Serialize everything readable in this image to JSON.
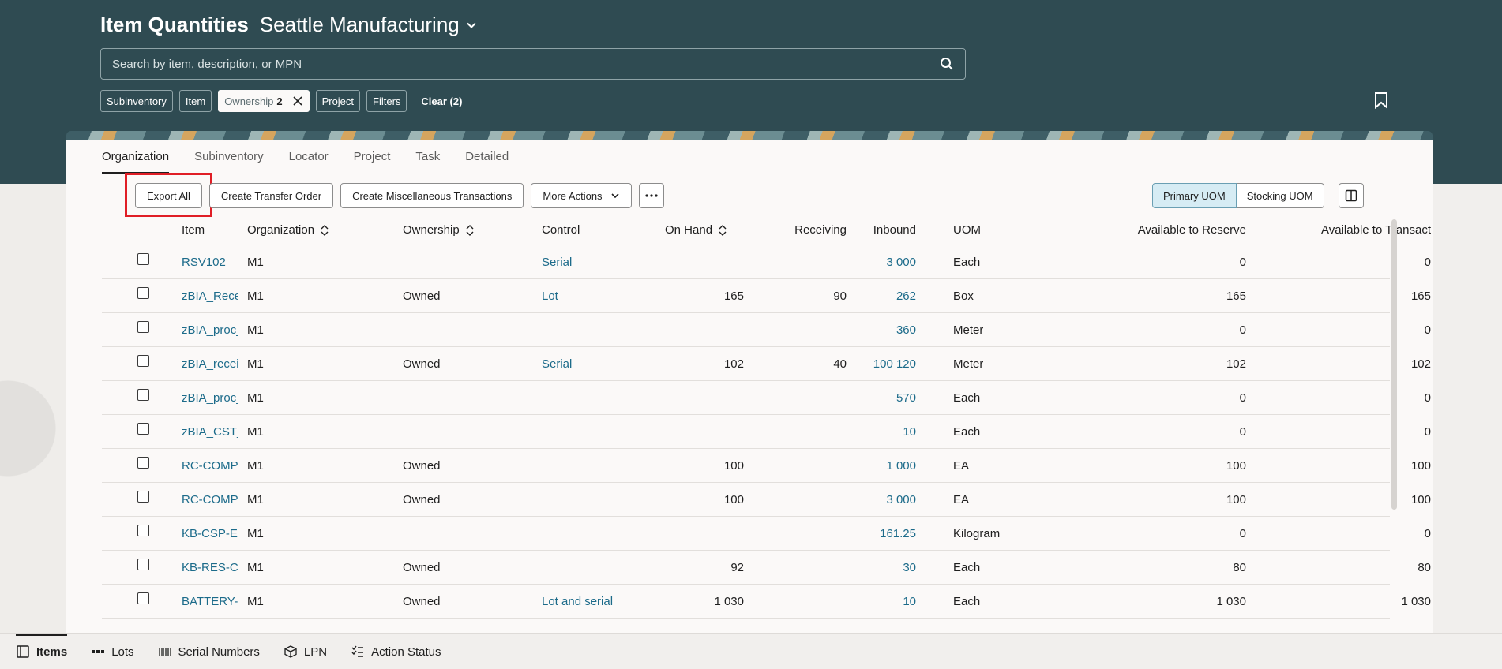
{
  "header": {
    "title": "Item Quantities",
    "organization": "Seattle Manufacturing",
    "search_placeholder": "Search by item, description, or MPN",
    "chips": {
      "subinventory": "Subinventory",
      "item": "Item",
      "ownership_label": "Ownership",
      "ownership_count": "2",
      "project": "Project",
      "filters": "Filters"
    },
    "clear_label": "Clear (2)"
  },
  "tabs": [
    "Organization",
    "Subinventory",
    "Locator",
    "Project",
    "Task",
    "Detailed"
  ],
  "toolbar": {
    "export_all": "Export All",
    "create_transfer_order": "Create Transfer Order",
    "create_misc_transactions": "Create Miscellaneous Transactions",
    "more_actions": "More Actions",
    "primary_uom": "Primary UOM",
    "stocking_uom": "Stocking UOM"
  },
  "table": {
    "columns": {
      "item": "Item",
      "organization": "Organization",
      "ownership": "Ownership",
      "control": "Control",
      "on_hand": "On Hand",
      "receiving": "Receiving",
      "inbound": "Inbound",
      "uom": "UOM",
      "available_to_reserve": "Available to Reserve",
      "available_to_transact": "Available to Transact"
    },
    "rows": [
      {
        "item": "RSV102",
        "org": "M1",
        "ownership": "",
        "control": "Serial",
        "on_hand": "",
        "receiving": "",
        "inbound": "3 000",
        "uom": "Each",
        "atr": "0",
        "att": "0"
      },
      {
        "item": "zBIA_Rece",
        "org": "M1",
        "ownership": "Owned",
        "control": "Lot",
        "on_hand": "165",
        "receiving": "90",
        "inbound": "262",
        "uom": "Box",
        "atr": "165",
        "att": "165"
      },
      {
        "item": "zBIA_proc_",
        "org": "M1",
        "ownership": "",
        "control": "",
        "on_hand": "",
        "receiving": "",
        "inbound": "360",
        "uom": "Meter",
        "atr": "0",
        "att": "0"
      },
      {
        "item": "zBIA_recei",
        "org": "M1",
        "ownership": "Owned",
        "control": "Serial",
        "on_hand": "102",
        "receiving": "40",
        "inbound": "100 120",
        "uom": "Meter",
        "atr": "102",
        "att": "102"
      },
      {
        "item": "zBIA_proc_",
        "org": "M1",
        "ownership": "",
        "control": "",
        "on_hand": "",
        "receiving": "",
        "inbound": "570",
        "uom": "Each",
        "atr": "0",
        "att": "0"
      },
      {
        "item": "zBIA_CST_",
        "org": "M1",
        "ownership": "",
        "control": "",
        "on_hand": "",
        "receiving": "",
        "inbound": "10",
        "uom": "Each",
        "atr": "0",
        "att": "0"
      },
      {
        "item": "RC-COMP-",
        "org": "M1",
        "ownership": "Owned",
        "control": "",
        "on_hand": "100",
        "receiving": "",
        "inbound": "1 000",
        "uom": "EA",
        "atr": "100",
        "att": "100"
      },
      {
        "item": "RC-COMP-",
        "org": "M1",
        "ownership": "Owned",
        "control": "",
        "on_hand": "100",
        "receiving": "",
        "inbound": "3 000",
        "uom": "EA",
        "atr": "100",
        "att": "100"
      },
      {
        "item": "KB-CSP-EI",
        "org": "M1",
        "ownership": "",
        "control": "",
        "on_hand": "",
        "receiving": "",
        "inbound": "161.25",
        "uom": "Kilogram",
        "atr": "0",
        "att": "0"
      },
      {
        "item": "KB-RES-C(",
        "org": "M1",
        "ownership": "Owned",
        "control": "",
        "on_hand": "92",
        "receiving": "",
        "inbound": "30",
        "uom": "Each",
        "atr": "80",
        "att": "80"
      },
      {
        "item": "BATTERY-",
        "org": "M1",
        "ownership": "Owned",
        "control": "Lot and serial",
        "on_hand": "1 030",
        "receiving": "",
        "inbound": "10",
        "uom": "Each",
        "atr": "1 030",
        "att": "1 030"
      }
    ]
  },
  "bottom_nav": [
    "Items",
    "Lots",
    "Serial Numbers",
    "LPN",
    "Action Status"
  ],
  "colors": {
    "header_bg": "#2f4b52",
    "link": "#1c6b8a",
    "highlight": "#e01e26",
    "selected_uom": "#d6ecf4"
  }
}
